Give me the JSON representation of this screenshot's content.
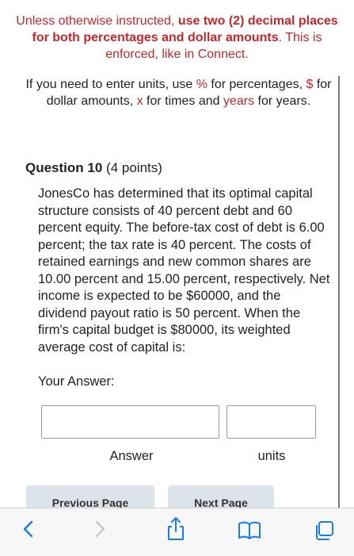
{
  "notice": {
    "prefix": "Unless otherwise instructed, ",
    "bold": "use two (2) decimal places for both percentages and dollar amounts",
    "suffix": ". This is enforced, like in Connect."
  },
  "units_help": {
    "part1": "If you need to enter units, use ",
    "percent_sym": "%",
    "part2": " for percentages, ",
    "dollar_sym": "$",
    "part3": " for dollar amounts, ",
    "times_sym": "x",
    "part4": " for times and ",
    "years_word": "years",
    "part5": " for years."
  },
  "question": {
    "label": "Question 10",
    "points": "(4 points)",
    "body": "JonesCo has determined that its optimal capital structure consists of 40 percent debt and 60 percent equity. The before-tax cost of debt is 6.00 percent; the tax rate is 40 percent. The costs of retained earnings and new common shares are 10.00 percent and 15.00 percent, respectively. Net income is expected to be $60000, and the dividend payout ratio is 50 percent. When the firm's capital budget is $80000, its weighted average cost of capital is:"
  },
  "answer": {
    "your_answer_label": "Your Answer:",
    "answer_value": "",
    "units_value": "",
    "answer_label": "Answer",
    "units_label": "units"
  },
  "nav": {
    "previous_label": "Previous Page",
    "next_label": "Next Page"
  },
  "toolbar": {
    "icons": [
      "back-icon",
      "forward-icon",
      "share-icon",
      "bookmarks-icon",
      "tabs-icon"
    ],
    "accent_color": "#1a7cf5",
    "disabled_color": "#c7c7cc"
  },
  "colors": {
    "notice_red": "#c8262b",
    "text": "#222222",
    "nav_button_bg": "#dde3ea"
  }
}
